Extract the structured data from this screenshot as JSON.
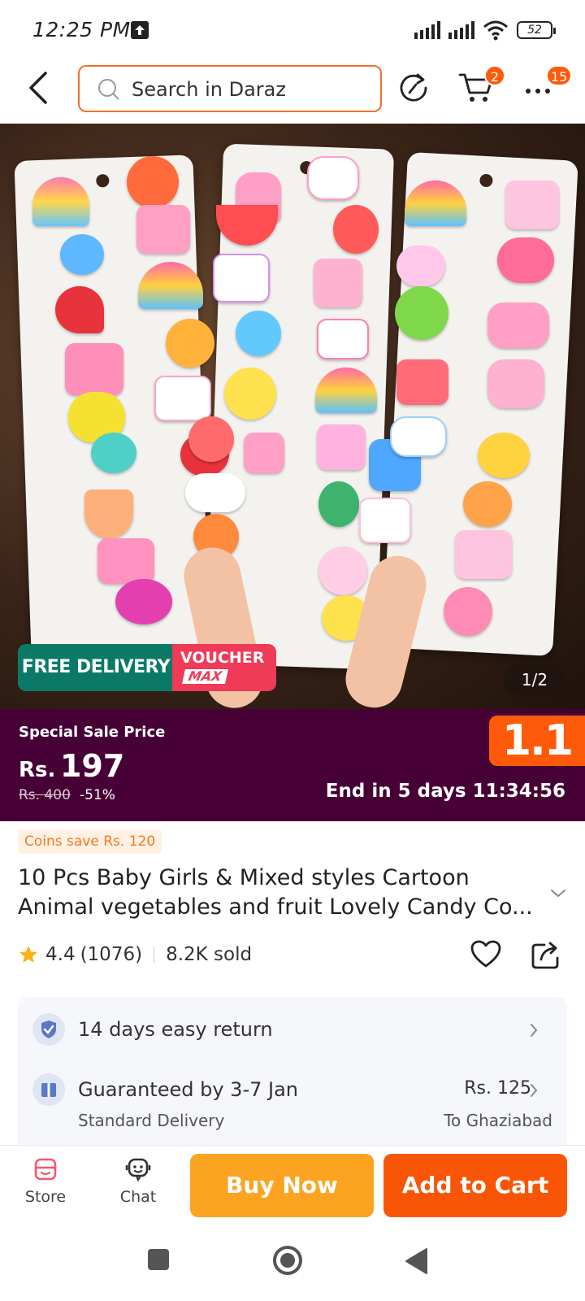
{
  "status_bar": {
    "time": "12:25 PM",
    "battery": "52",
    "icons": [
      "upload-icon",
      "signal-icon",
      "signal-icon",
      "wifi-icon",
      "battery-icon"
    ]
  },
  "header": {
    "search_placeholder": "Search in Daraz",
    "cart_badge": "2",
    "more_badge": "15",
    "accent_color": "#f0702a"
  },
  "gallery": {
    "free_delivery": "FREE DELIVERY",
    "voucher_title": "VOUCHER",
    "voucher_sub": "MAX",
    "pager": "1/2"
  },
  "price": {
    "label": "Special Sale Price",
    "currency": "Rs.",
    "amount": "197",
    "original": "Rs. 400",
    "discount": "-51%",
    "campaign": "1.1",
    "countdown": "End in 5 days 11:34:56",
    "band_color": "#470035"
  },
  "product": {
    "coins": "Coins save Rs. 120",
    "title": "10 Pcs Baby Girls & Mixed styles Cartoon Animal vegetables and fruit Lovely Candy Co...",
    "rating": "4.4",
    "reviews": "(1076)",
    "sold": "8.2K sold"
  },
  "service": {
    "return": "14 days easy return",
    "delivery": "Guaranteed by 3-7 Jan",
    "delivery_type": "Standard Delivery",
    "delivery_price": "Rs. 125",
    "location": "To Ghaziabad"
  },
  "actions": {
    "store": "Store",
    "chat": "Chat",
    "buy_now": "Buy Now",
    "add_to_cart": "Add to Cart"
  }
}
